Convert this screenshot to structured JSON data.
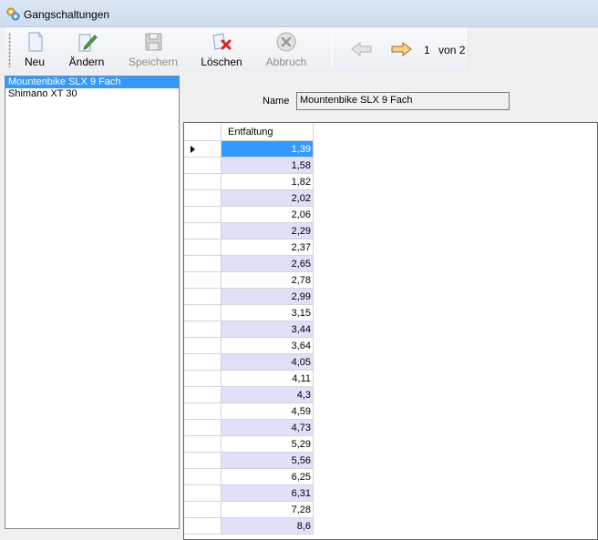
{
  "window": {
    "title": "Gangschaltungen",
    "icon": "gears-icon"
  },
  "toolbar": {
    "buttons": [
      {
        "label": "Neu",
        "icon": "new-document-icon",
        "enabled": true
      },
      {
        "label": "Ändern",
        "icon": "edit-pencil-icon",
        "enabled": true
      },
      {
        "label": "Speichern",
        "icon": "save-disk-icon",
        "enabled": false
      },
      {
        "label": "Löschen",
        "icon": "delete-cross-icon",
        "enabled": true
      },
      {
        "label": "Abbruch",
        "icon": "cancel-circle-icon",
        "enabled": false
      }
    ],
    "nav": {
      "prev_icon": "arrow-left-icon",
      "next_icon": "arrow-right-icon",
      "current": "1",
      "of_label": "von 2"
    }
  },
  "list": {
    "items": [
      "Mountenbike SLX 9 Fach",
      "Shimano XT 30"
    ],
    "selected_index": 0
  },
  "form": {
    "name_label": "Name",
    "name_value": "Mountenbike SLX 9 Fach"
  },
  "grid": {
    "column_header": "Entfaltung",
    "rows": [
      "1,39",
      "1,58",
      "1,82",
      "2,02",
      "2,06",
      "2,29",
      "2,37",
      "2,65",
      "2,78",
      "2,99",
      "3,15",
      "3,44",
      "3,64",
      "4,05",
      "4,11",
      "4,3",
      "4,59",
      "4,73",
      "5,29",
      "5,56",
      "6,25",
      "6,31",
      "7,28",
      "8,6"
    ],
    "current_row": 0
  },
  "colors": {
    "selection": "#3399ff",
    "alt_row": "#e0e0f8",
    "delete_red": "#e02020",
    "nav_arrow": "#e0b060"
  }
}
